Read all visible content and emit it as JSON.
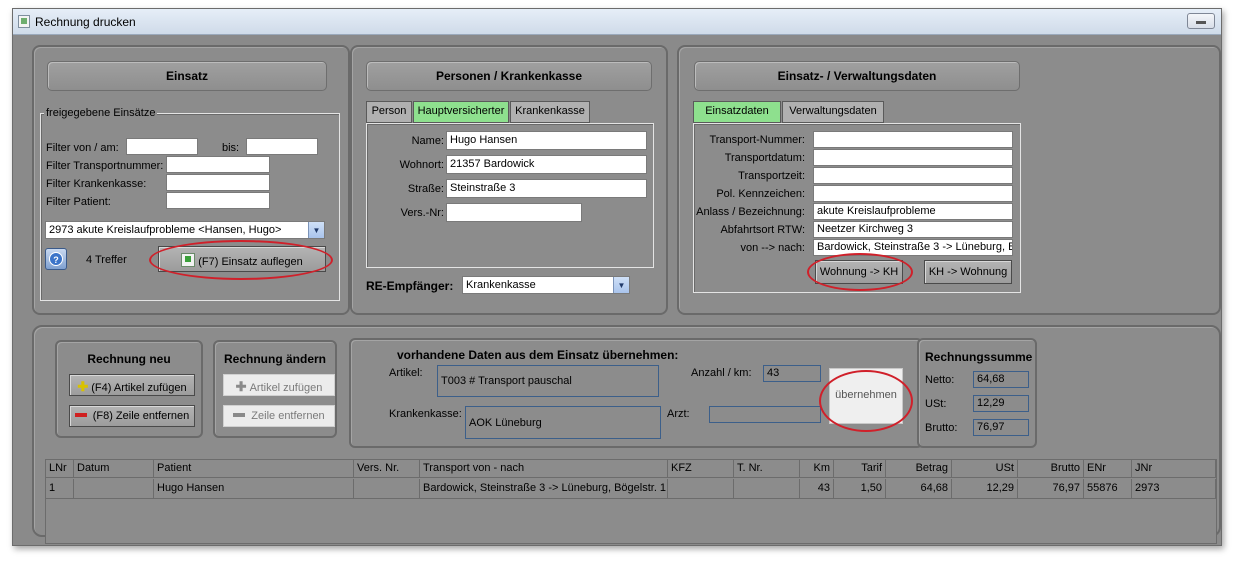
{
  "window": {
    "title": "Rechnung drucken"
  },
  "einsatz": {
    "header": "Einsatz",
    "group_label": "freigegebene Einsätze",
    "filter_from_label": "Filter von / am:",
    "filter_from_value": "",
    "filter_to_label": "bis:",
    "filter_to_value": "",
    "filter_transport_label": "Filter Transportnummer:",
    "filter_transport_value": "",
    "filter_kasse_label": "Filter Krankenkasse:",
    "filter_kasse_value": "",
    "filter_patient_label": "Filter Patient:",
    "filter_patient_value": "",
    "selected": "2973  akute Kreislaufprobleme  <Hansen, Hugo>",
    "hits": "4 Treffer",
    "load_button": "(F7) Einsatz auflegen"
  },
  "personen": {
    "header": "Personen / Krankenkasse",
    "tabs": [
      "Person",
      "Hauptversicherter",
      "Krankenkasse"
    ],
    "active_tab": 1,
    "name_label": "Name:",
    "name_value": "Hugo Hansen",
    "wohnort_label": "Wohnort:",
    "wohnort_value": "21357 Bardowick",
    "strasse_label": "Straße:",
    "strasse_value": "Steinstraße 3",
    "versnr_label": "Vers.-Nr:",
    "versnr_value": "",
    "re_label": "RE-Empfänger:",
    "re_value": "Krankenkasse"
  },
  "verwaltung": {
    "header": "Einsatz- / Verwaltungsdaten",
    "tabs": [
      "Einsatzdaten",
      "Verwaltungsdaten"
    ],
    "active_tab": 0,
    "fields": [
      {
        "label": "Transport-Nummer:",
        "value": ""
      },
      {
        "label": "Transportdatum:",
        "value": ""
      },
      {
        "label": "Transportzeit:",
        "value": ""
      },
      {
        "label": "Pol. Kennzeichen:",
        "value": ""
      },
      {
        "label": "Anlass /  Bezeichnung:",
        "value": "akute Kreislaufprobleme"
      },
      {
        "label": "Abfahrtsort RTW:",
        "value": " Neetzer Kirchweg 3"
      },
      {
        "label": "von --> nach:",
        "value": "Bardowick, Steinstraße 3 -> Lüneburg, Bö"
      }
    ],
    "btn_wohnung_kh": "Wohnung -> KH",
    "btn_kh_wohnung": "KH -> Wohnung"
  },
  "rechnung_neu": {
    "header": "Rechnung neu",
    "add": "(F4) Artikel zufügen",
    "remove": "(F8) Zeile entfernen"
  },
  "rechnung_aendern": {
    "header": "Rechnung ändern",
    "add": "Artikel zufügen",
    "remove": "Zeile entfernen"
  },
  "uebernahme": {
    "header": "vorhandene Daten aus dem Einsatz übernehmen:",
    "artikel_label": "Artikel:",
    "artikel_value": "T003 # Transport pauschal",
    "anzahl_label": "Anzahl / km:",
    "anzahl_value": "43",
    "kasse_label": "Krankenkasse:",
    "kasse_value": "AOK Lüneburg",
    "arzt_label": "Arzt:",
    "arzt_value": "",
    "button": "übernehmen"
  },
  "summe": {
    "header": "Rechnungssumme",
    "netto_label": "Netto:",
    "netto": "64,68",
    "ust_label": "USt:",
    "ust": "12,29",
    "brutto_label": "Brutto:",
    "brutto": "76,97"
  },
  "table": {
    "headers": [
      "LNr",
      "Datum",
      "Patient",
      "Vers. Nr.",
      "Transport von - nach",
      "KFZ",
      "T. Nr.",
      "Km",
      "Tarif",
      "Betrag",
      "USt",
      "Brutto",
      "ENr",
      "JNr"
    ],
    "rows": [
      [
        "1",
        "",
        "Hugo Hansen",
        "",
        "Bardowick, Steinstraße 3 -> Lüneburg, Bögelstr. 1",
        "",
        "",
        "43",
        "1,50",
        "64,68",
        "12,29",
        "76,97",
        "55876",
        "2973"
      ]
    ]
  },
  "colors": {
    "active_tab": "#8ee08e",
    "annotation": "#d0202a",
    "panel": "#8c8c8c"
  },
  "icons": [
    "help-icon",
    "load-icon",
    "plus-icon",
    "minus-icon"
  ]
}
